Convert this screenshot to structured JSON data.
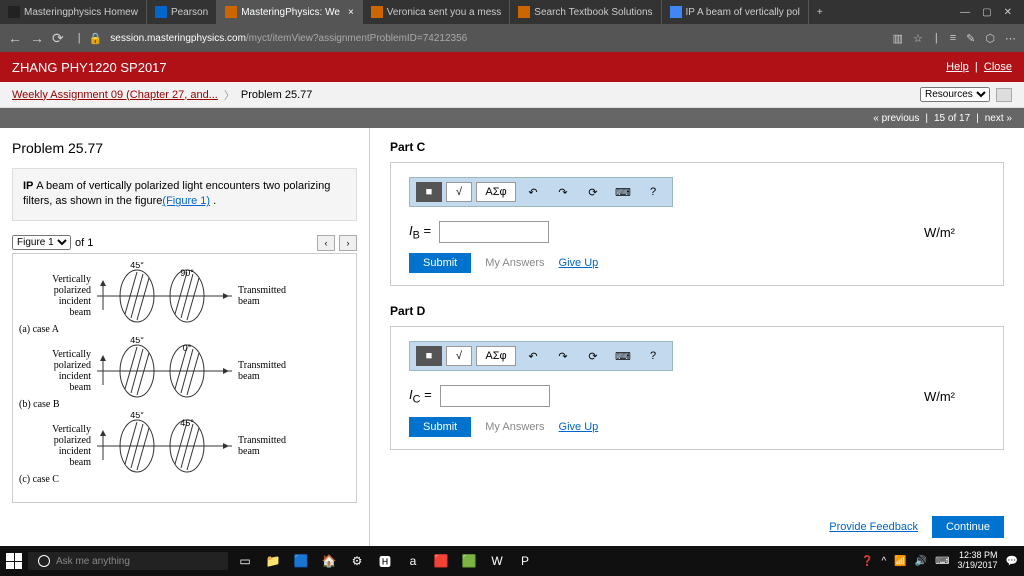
{
  "tabs": [
    {
      "label": "Masteringphysics Homew"
    },
    {
      "label": "Pearson"
    },
    {
      "label": "MasteringPhysics: We"
    },
    {
      "label": "Veronica sent you a mess"
    },
    {
      "label": "Search Textbook Solutions"
    },
    {
      "label": "IP A beam of vertically pol"
    }
  ],
  "url": {
    "domain": "session.masteringphysics.com",
    "path": "/myct/itemView?assignmentProblemID=74212356"
  },
  "course_header": "ZHANG PHY1220 SP2017",
  "header_links": {
    "help": "Help",
    "close": "Close"
  },
  "breadcrumb": {
    "assignment": "Weekly Assignment 09 (Chapter 27, and...",
    "problem": "Problem 25.77",
    "resources": "Resources"
  },
  "navbar": {
    "prev": "« previous",
    "pos": "15 of 17",
    "next": "next »"
  },
  "problem": {
    "title": "Problem 25.77",
    "desc_prefix": "IP ",
    "desc": "A beam of vertically polarized light encounters two polarizing filters, as shown in the figure",
    "figlink": "(Figure 1)",
    "desc_end": " ."
  },
  "figure": {
    "select": "Figure 1",
    "of": "of 1",
    "left_label": "Vertically polarized incident beam",
    "right_label": "Transmitted beam",
    "cases": [
      {
        "a1": "45°",
        "a2": "90°",
        "name": "(a) case A"
      },
      {
        "a1": "45°",
        "a2": "0°",
        "name": "(b) case B"
      },
      {
        "a1": "45°",
        "a2": "45°",
        "name": "(c) case C"
      }
    ]
  },
  "parts": {
    "c": {
      "label": "Part C",
      "var": "I",
      "sub": "B",
      "unit": "W/m²"
    },
    "d": {
      "label": "Part D",
      "var": "I",
      "sub": "C",
      "unit": "W/m²"
    }
  },
  "buttons": {
    "submit": "Submit",
    "my_answers": "My Answers",
    "give_up": "Give Up",
    "feedback": "Provide Feedback",
    "continue": "Continue"
  },
  "toolbar_symbols": {
    "templates": "■",
    "sqrt": "√",
    "greek": "ΑΣφ",
    "undo": "↶",
    "redo": "↷",
    "reset": "⟳",
    "keyboard": "⌨",
    "help": "?"
  },
  "taskbar": {
    "search": "Ask me anything",
    "time": "12:38 PM",
    "date": "3/19/2017"
  }
}
